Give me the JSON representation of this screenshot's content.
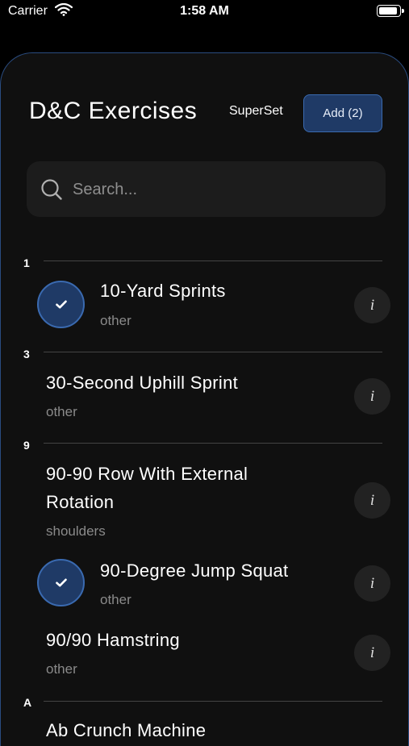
{
  "status_bar": {
    "carrier": "Carrier",
    "time": "1:58 AM"
  },
  "header": {
    "title": "D&C Exercises",
    "superset_label": "SuperSet",
    "add_label": "Add (2)"
  },
  "search": {
    "placeholder": "Search..."
  },
  "sections": [
    {
      "header": "1",
      "items": [
        {
          "title": "10-Yard Sprints",
          "category": "other",
          "selected": true,
          "info": "i"
        }
      ]
    },
    {
      "header": "3",
      "items": [
        {
          "title": "30-Second Uphill Sprint",
          "category": "other",
          "selected": false,
          "info": "i"
        }
      ]
    },
    {
      "header": "9",
      "items": [
        {
          "title_line1": "90-90 Row With External",
          "title_line2": "Rotation",
          "category": "shoulders",
          "selected": false,
          "info": "i"
        },
        {
          "title": "90-Degree Jump Squat",
          "category": "other",
          "selected": true,
          "info": "i"
        },
        {
          "title": "90/90 Hamstring",
          "category": "other",
          "selected": false,
          "info": "i"
        }
      ]
    },
    {
      "header": "A",
      "items": [
        {
          "title": "Ab Crunch Machine"
        }
      ]
    }
  ],
  "icons": {
    "check": "checkmark-icon",
    "search": "search-icon",
    "info": "info-icon",
    "wifi": "wifi-icon",
    "battery": "battery-icon"
  },
  "colors": {
    "accent": "#1f3a66",
    "accent_border": "#3a6ab0",
    "background": "#101010"
  }
}
